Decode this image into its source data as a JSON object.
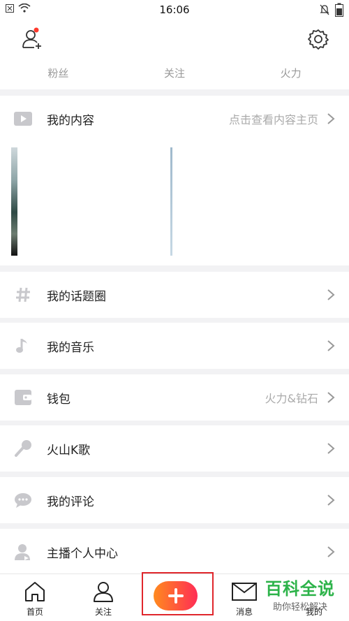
{
  "status_bar": {
    "time": "16:06"
  },
  "stats": [
    "粉丝",
    "关注",
    "火力"
  ],
  "content_section": {
    "label": "我的内容",
    "sub": "点击查看内容主页"
  },
  "menu": [
    {
      "label": "我的话题圈",
      "icon": "hash-icon",
      "sub": ""
    },
    {
      "label": "我的音乐",
      "icon": "music-note-icon",
      "sub": ""
    },
    {
      "label": "钱包",
      "icon": "wallet-icon",
      "sub": "火力&钻石"
    },
    {
      "label": "火山K歌",
      "icon": "microphone-icon",
      "sub": ""
    },
    {
      "label": "我的评论",
      "icon": "comment-icon",
      "sub": ""
    },
    {
      "label": "主播个人中心",
      "icon": "anchor-user-icon",
      "sub": ""
    }
  ],
  "tabbar": {
    "home": "首页",
    "follow": "关注",
    "messages": "消息",
    "me": "我的"
  },
  "watermark": {
    "title": "百科全说",
    "subtitle": "助你轻松解决"
  },
  "colors": {
    "accent_start": "#ff8a1f",
    "accent_end": "#ff2d55",
    "highlight_box": "#e0262c",
    "watermark": "#2db34a"
  }
}
